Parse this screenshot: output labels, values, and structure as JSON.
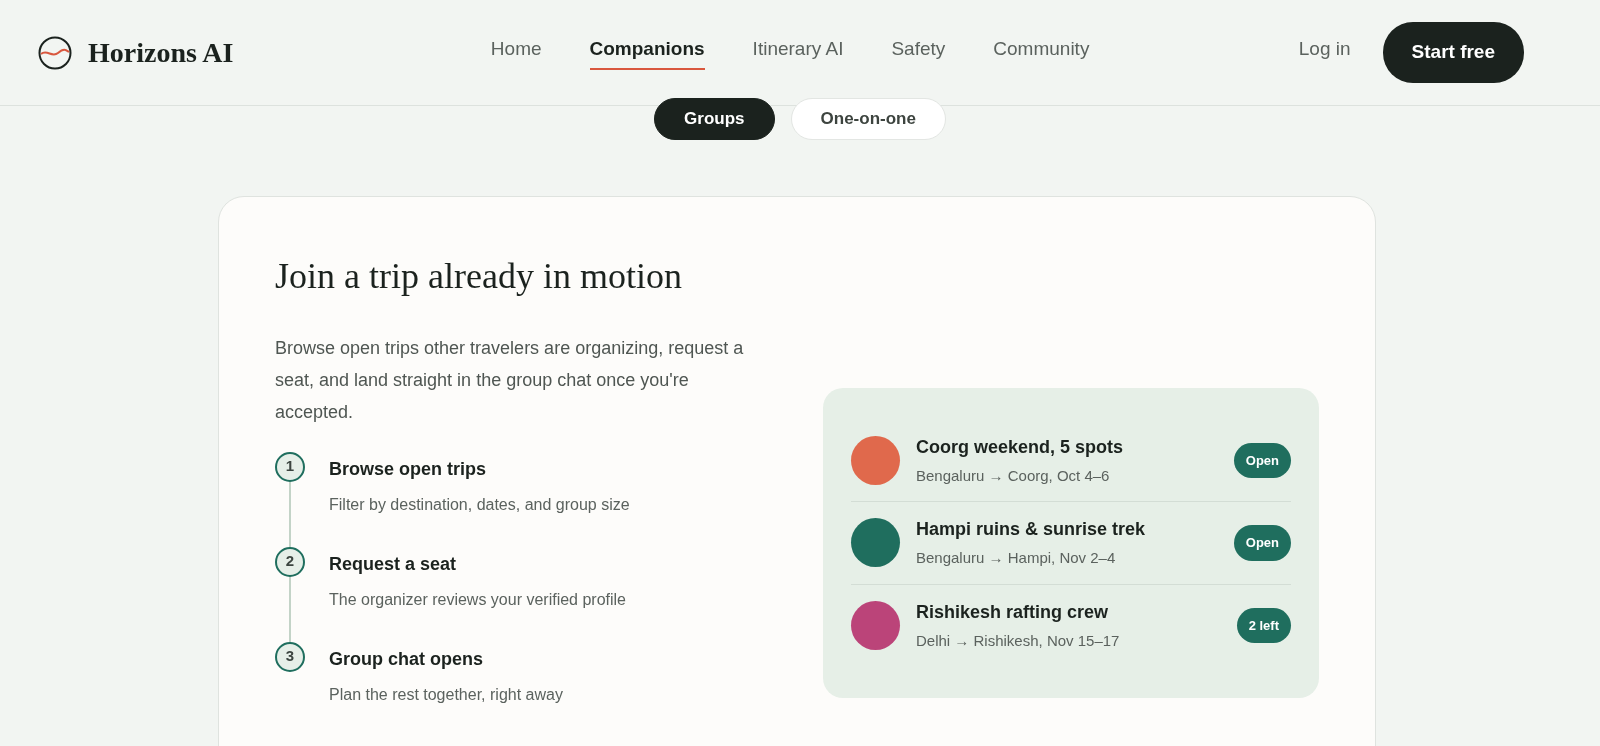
{
  "header": {
    "brand": "Horizons AI",
    "nav": [
      {
        "label": "Home",
        "selected": false
      },
      {
        "label": "Companions",
        "selected": true
      },
      {
        "label": "Itinerary AI",
        "selected": false
      },
      {
        "label": "Safety",
        "selected": false
      },
      {
        "label": "Community",
        "selected": false
      }
    ],
    "login": "Log in",
    "cta": "Start free"
  },
  "mode_tabs": [
    {
      "label": "Groups",
      "selected": true
    },
    {
      "label": "One-on-one",
      "selected": false
    }
  ],
  "section": {
    "title": "Join a trip already in motion",
    "description": "Browse open trips other travelers are organizing, request a seat, and land straight in the group chat once you're accepted.",
    "steps": [
      {
        "number": "1",
        "title": "Browse open trips",
        "text": "Filter by destination, dates, and group size"
      },
      {
        "number": "2",
        "title": "Request a seat",
        "text": "The organizer reviews your verified profile"
      },
      {
        "number": "3",
        "title": "Group chat opens",
        "text": "Plan the rest together, right away"
      }
    ],
    "trips": [
      {
        "title": "Coorg weekend, 5 spots",
        "route": "Bengaluru → Coorg, Oct 4–6",
        "status": "Open",
        "color": "#e0694c"
      },
      {
        "title": "Hampi ruins & sunrise trek",
        "route": "Bengaluru → Hampi, Nov 2–4",
        "status": "Open",
        "color": "#1f6e5e"
      },
      {
        "title": "Rishikesh rafting crew",
        "route": "Delhi → Rishikesh, Nov 15–17",
        "status": "2 left",
        "color": "#bb4479"
      }
    ]
  }
}
